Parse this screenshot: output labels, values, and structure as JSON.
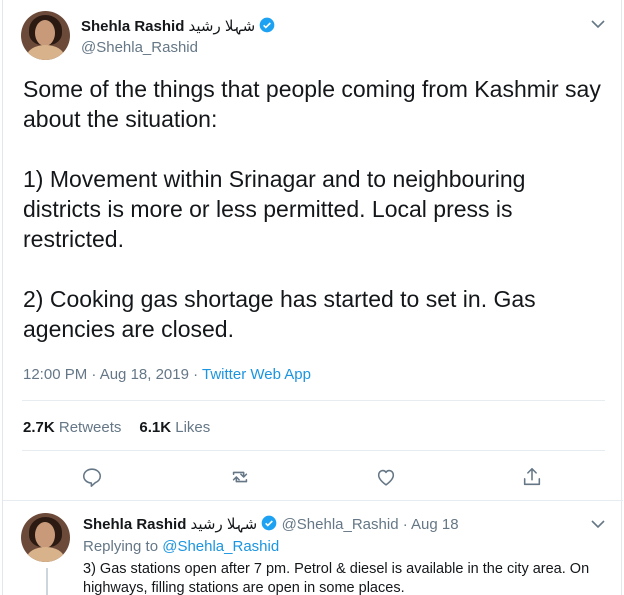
{
  "main_tweet": {
    "author_name": "Shehla Rashid",
    "author_name_urdu": "شہلا رشید",
    "handle": "@Shehla_Rashid",
    "paragraphs": [
      "Some of the things that people coming from Kashmir say about the situation:",
      "1) Movement within Srinagar and to neighbouring districts is more or less permitted. Local press is restricted.",
      "2) Cooking gas shortage has started to set in. Gas agencies are closed."
    ],
    "timestamp": "12:00 PM · Aug 18, 2019 · ",
    "source_app": "Twitter Web App",
    "retweets_count": "2.7K",
    "retweets_label": "Retweets",
    "likes_count": "6.1K",
    "likes_label": "Likes"
  },
  "reply_tweet": {
    "author_name": "Shehla Rashid",
    "author_name_urdu": "شہلا رشید",
    "handle_date": "@Shehla_Rashid · Aug 18",
    "replying_prefix": "Replying to ",
    "replying_to": "@Shehla_Rashid",
    "text": "3) Gas stations open after 7 pm. Petrol & diesel is available in the city area. On highways, filling stations are open in some places."
  },
  "colors": {
    "accent": "#1b95e0",
    "verified": "#1da1f2",
    "muted": "#657786",
    "text": "#14171a"
  },
  "icons": [
    "chevron-down-icon",
    "verified-badge-icon",
    "reply-icon",
    "retweet-icon",
    "like-icon",
    "share-icon"
  ]
}
